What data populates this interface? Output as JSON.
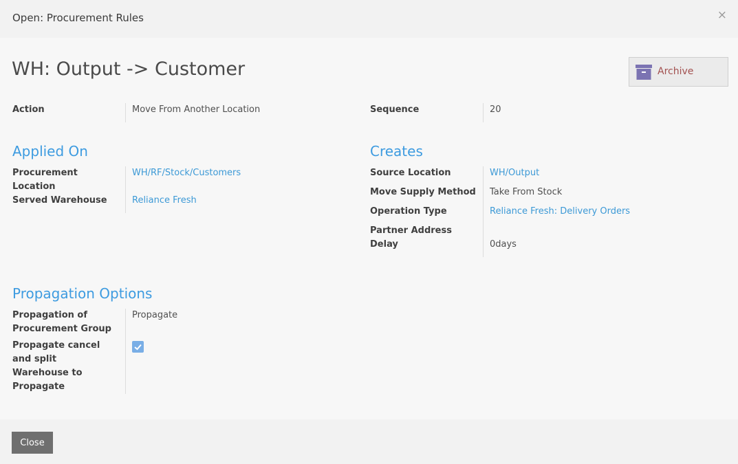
{
  "dialog": {
    "title": "Open: Procurement Rules",
    "close_symbol": "×"
  },
  "record": {
    "name": "WH: Output -> Customer"
  },
  "archive": {
    "label": "Archive",
    "icon": "archive-box-icon",
    "icon_color": "#7b73b2",
    "label_color": "#a2504f"
  },
  "top_fields": {
    "action": {
      "label": "Action",
      "value": "Move From Another Location"
    },
    "sequence": {
      "label": "Sequence",
      "value": "20"
    }
  },
  "applied_on": {
    "title": "Applied On",
    "procurement_location": {
      "label_line1": "Procurement",
      "label_line2": "Location",
      "value": "WH/RF/Stock/Customers"
    },
    "served_warehouse": {
      "label": "Served Warehouse",
      "value": "Reliance Fresh"
    }
  },
  "creates": {
    "title": "Creates",
    "source_location": {
      "label": "Source Location",
      "value": "WH/Output"
    },
    "move_supply_method": {
      "label": "Move Supply Method",
      "value": "Take From Stock"
    },
    "operation_type": {
      "label": "Operation Type",
      "value": "Reliance Fresh: Delivery Orders"
    },
    "partner_address": {
      "label": "Partner Address",
      "value": ""
    },
    "delay": {
      "label": "Delay",
      "value": "0days"
    }
  },
  "propagation": {
    "title": "Propagation Options",
    "group": {
      "label_line1": "Propagation of",
      "label_line2": "Procurement Group",
      "value": "Propagate"
    },
    "cancel_split": {
      "label_line1": "Propagate cancel",
      "label_line2": "and split",
      "checked": true
    },
    "warehouse": {
      "label_line1": "Warehouse to",
      "label_line2": "Propagate",
      "value": ""
    }
  },
  "footer": {
    "close_label": "Close"
  },
  "colors": {
    "link": "#3c99d6",
    "section": "#3d9be0",
    "checkbox": "#79aee6",
    "close_button": "#6f6f6f"
  }
}
